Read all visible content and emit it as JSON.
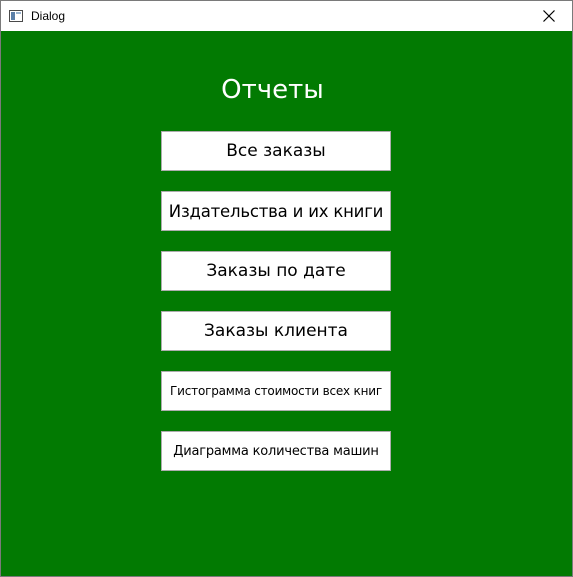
{
  "window": {
    "title": "Dialog",
    "close_icon": "close-icon",
    "app_icon": "window-app-icon"
  },
  "main": {
    "heading": "Отчеты",
    "background_color": "#027a02",
    "buttons": [
      {
        "label": "Все заказы"
      },
      {
        "label": "Издательства и их книги"
      },
      {
        "label": "Заказы по дате"
      },
      {
        "label": "Заказы клиента"
      },
      {
        "label": "Гистограмма стоимости всех книг"
      },
      {
        "label": "Диаграмма количества машин"
      }
    ]
  }
}
